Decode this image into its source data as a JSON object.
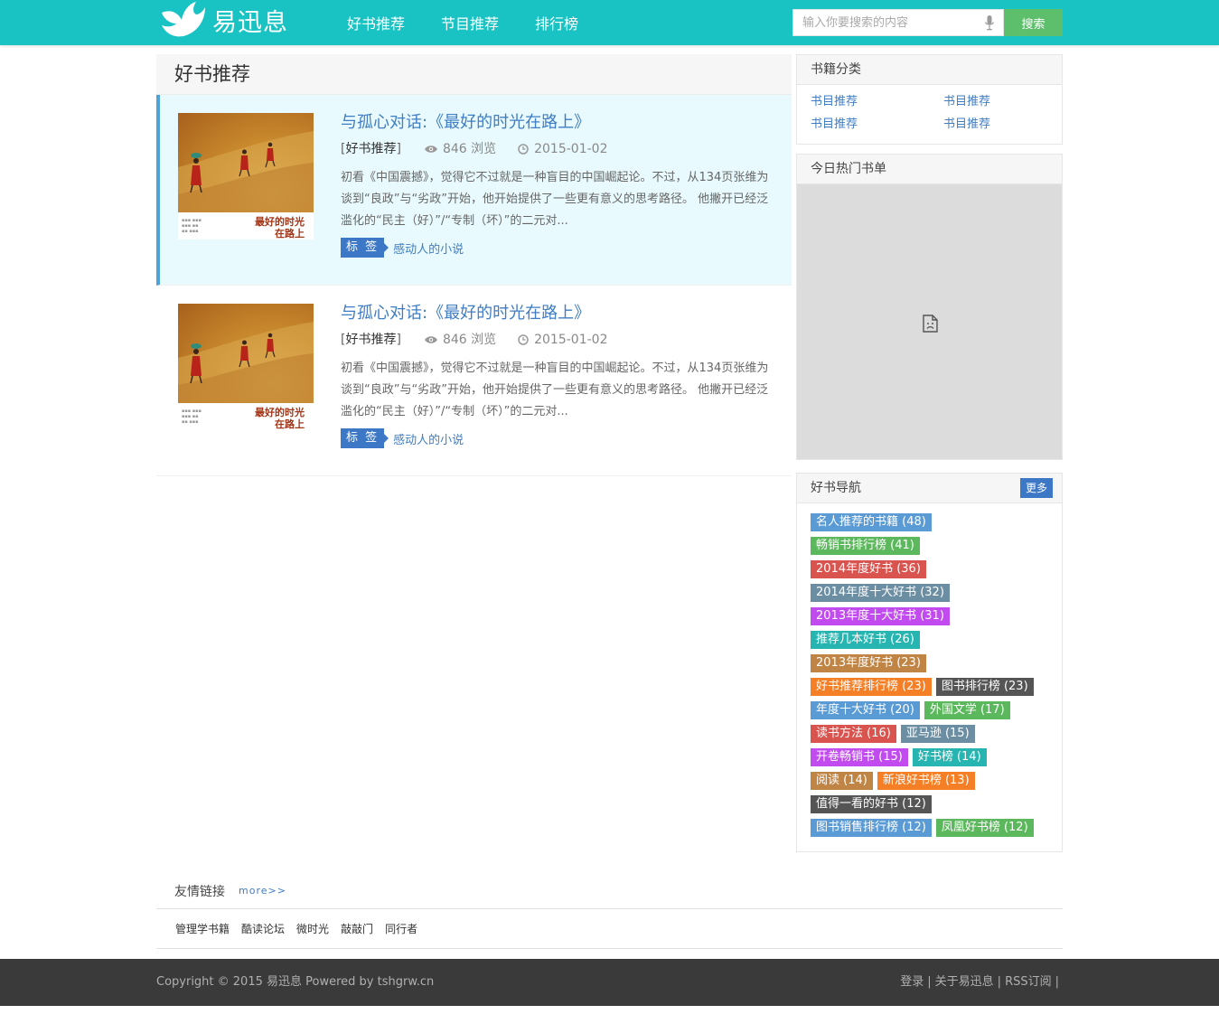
{
  "header": {
    "logo_text": "易迅息",
    "nav": [
      "好书推荐",
      "节目推荐",
      "排行榜"
    ],
    "search_placeholder": "输入你要搜索的内容",
    "search_button": "搜索",
    "accent_color": "#19c3c3"
  },
  "main": {
    "section_title": "好书推荐",
    "articles": [
      {
        "title": "与孤心对话:《最好的时光在路上》",
        "category": "好书推荐",
        "views": "846 浏览",
        "date": "2015-01-02",
        "excerpt": "初看《中国震撼》，觉得它不过就是一种盲目的中国崛起论。不过，从134页张维为谈到“良政”与“劣政”开始，他开始提供了一些更有意义的思考路径。 他撇开已经泛滥化的“民主（好）”/“专制（坏）”的二元对...",
        "tag_label": "标 签",
        "tag": "感动人的小说",
        "cover_title": "最好的时光\n在路上",
        "highlighted": true
      },
      {
        "title": "与孤心对话:《最好的时光在路上》",
        "category": "好书推荐",
        "views": "846 浏览",
        "date": "2015-01-02",
        "excerpt": "初看《中国震撼》，觉得它不过就是一种盲目的中国崛起论。不过，从134页张维为谈到“良政”与“劣政”开始，他开始提供了一些更有意义的思考路径。 他撇开已经泛滥化的“民主（好）”/“专制（坏）”的二元对...",
        "tag_label": "标 签",
        "tag": "感动人的小说",
        "cover_title": "最好的时光\n在路上",
        "highlighted": false
      }
    ]
  },
  "sidebar": {
    "categories_title": "书籍分类",
    "categories": [
      "书目推荐",
      "书目推荐",
      "书目推荐",
      "书目推荐"
    ],
    "hot_title": "今日热门书单",
    "nav_title": "好书导航",
    "more_label": "更多",
    "nav_rows": [
      [
        {
          "label": "名人推荐的书籍 (48)",
          "color": "#5b9bd5"
        }
      ],
      [
        {
          "label": "畅销书排行榜 (41)",
          "color": "#5cb85c"
        }
      ],
      [
        {
          "label": "2014年度好书 (36)",
          "color": "#d9534f"
        }
      ],
      [
        {
          "label": "2014年度十大好书 (32)",
          "color": "#6c8ea3"
        }
      ],
      [
        {
          "label": "2013年度十大好书 (31)",
          "color": "#c24bf0"
        }
      ],
      [
        {
          "label": "推荐几本好书 (26)",
          "color": "#26b5b0"
        }
      ],
      [
        {
          "label": "2013年度好书 (23)",
          "color": "#c08545"
        }
      ],
      [
        {
          "label": "好书推荐排行榜 (23)",
          "color": "#f57f26"
        },
        {
          "label": "图书排行榜 (23)",
          "color": "#555555"
        }
      ],
      [
        {
          "label": "年度十大好书 (20)",
          "color": "#5b9bd5"
        },
        {
          "label": "外国文学 (17)",
          "color": "#5cb85c"
        }
      ],
      [
        {
          "label": "读书方法 (16)",
          "color": "#d9534f"
        },
        {
          "label": "亚马逊 (15)",
          "color": "#6c8ea3"
        }
      ],
      [
        {
          "label": "开卷畅销书 (15)",
          "color": "#c24bf0"
        },
        {
          "label": "好书榜 (14)",
          "color": "#26b5b0"
        }
      ],
      [
        {
          "label": "阅读 (14)",
          "color": "#c08545"
        },
        {
          "label": "新浪好书榜 (13)",
          "color": "#f57f26"
        }
      ],
      [
        {
          "label": "值得一看的好书 (12)",
          "color": "#555555"
        }
      ],
      [
        {
          "label": "图书销售排行榜 (12)",
          "color": "#5b9bd5"
        },
        {
          "label": "凤凰好书榜 (12)",
          "color": "#5cb85c"
        }
      ]
    ]
  },
  "links": {
    "title": "友情链接",
    "more": "more>>",
    "items": [
      "管理学书籍",
      "酷读论坛",
      "微时光",
      "敲敲门",
      "同行者"
    ]
  },
  "footer": {
    "copyright": "Copyright © 2015 易迅息 Powered by tshgrw.cn",
    "links": [
      "登录",
      "关于易迅息",
      "RSS订阅"
    ],
    "separator": "|"
  }
}
